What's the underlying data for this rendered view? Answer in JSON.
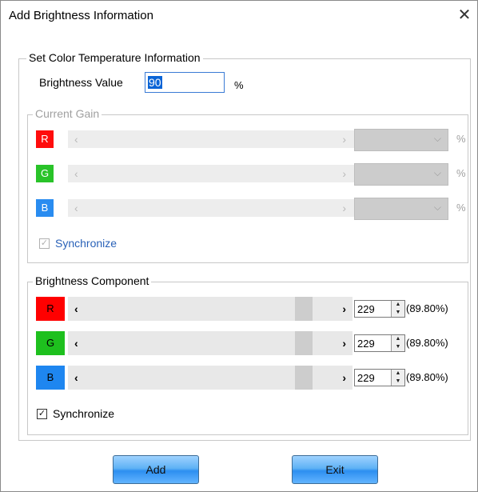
{
  "window": {
    "title": "Add Brightness Information",
    "close_glyph": "✕"
  },
  "color_temp": {
    "legend": "Set Color Temperature Information",
    "brightness_label": "Brightness Value",
    "brightness_value": "90",
    "brightness_unit": "%"
  },
  "current_gain": {
    "legend": "Current Gain",
    "channels": [
      {
        "label": "R",
        "color": "#ff0000",
        "unit": "%"
      },
      {
        "label": "G",
        "color": "#1ec01e",
        "unit": "%"
      },
      {
        "label": "B",
        "color": "#1e86f0",
        "unit": "%"
      }
    ],
    "sync_label": "Synchronize",
    "sync_checked": true
  },
  "brightness_component": {
    "legend": "Brightness Component",
    "channels": [
      {
        "label": "R",
        "color": "#ff0000",
        "value": "229",
        "percent": "(89.80%)",
        "level": 0.898
      },
      {
        "label": "G",
        "color": "#1ec01e",
        "value": "229",
        "percent": "(89.80%)",
        "level": 0.898
      },
      {
        "label": "B",
        "color": "#1e86f0",
        "value": "229",
        "percent": "(89.80%)",
        "level": 0.898
      }
    ],
    "sync_label": "Synchronize",
    "sync_checked": true
  },
  "buttons": {
    "add": "Add",
    "exit": "Exit"
  },
  "glyphs": {
    "left": "‹",
    "right": "›",
    "chevron_down": "⌵",
    "check": "✓",
    "up": "▲",
    "down": "▼"
  }
}
